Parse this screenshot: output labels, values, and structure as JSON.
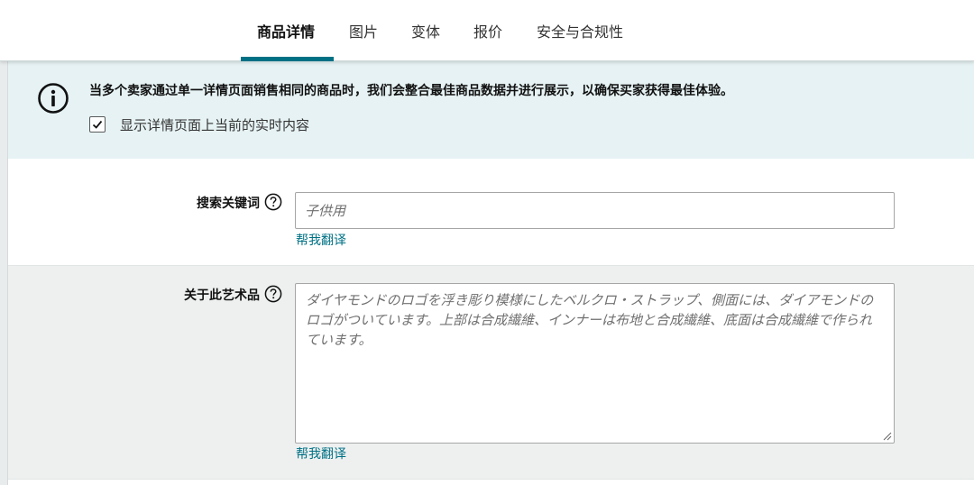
{
  "tabs": [
    {
      "label": "商品详情",
      "active": true
    },
    {
      "label": "图片",
      "active": false
    },
    {
      "label": "变体",
      "active": false
    },
    {
      "label": "报价",
      "active": false
    },
    {
      "label": "安全与合规性",
      "active": false
    }
  ],
  "banner": {
    "text": "当多个卖家通过单一详情页面销售相同的商品时，我们会整合最佳商品数据并进行展示，以确保买家获得最佳体验。",
    "checkbox_label": "显示详情页面上当前的实时内容",
    "checkbox_checked": true
  },
  "search_keywords": {
    "label": "搜索关键词",
    "placeholder": "子供用",
    "translate_link": "帮我翻译"
  },
  "about_artwork": {
    "label": "关于此艺术品",
    "placeholder": "ダイヤモンドのロゴを浮き彫り模様にしたベルクロ・ストラップ、側面には、ダイアモンドのロゴがついています。上部は合成繊維、インナーは布地と合成繊維、底面は合成繊維で作られています。",
    "translate_link": "帮我翻译"
  },
  "colors": {
    "accent": "#007185",
    "banner_bg": "#e6f2f3",
    "section_gray": "#eef0f0"
  }
}
